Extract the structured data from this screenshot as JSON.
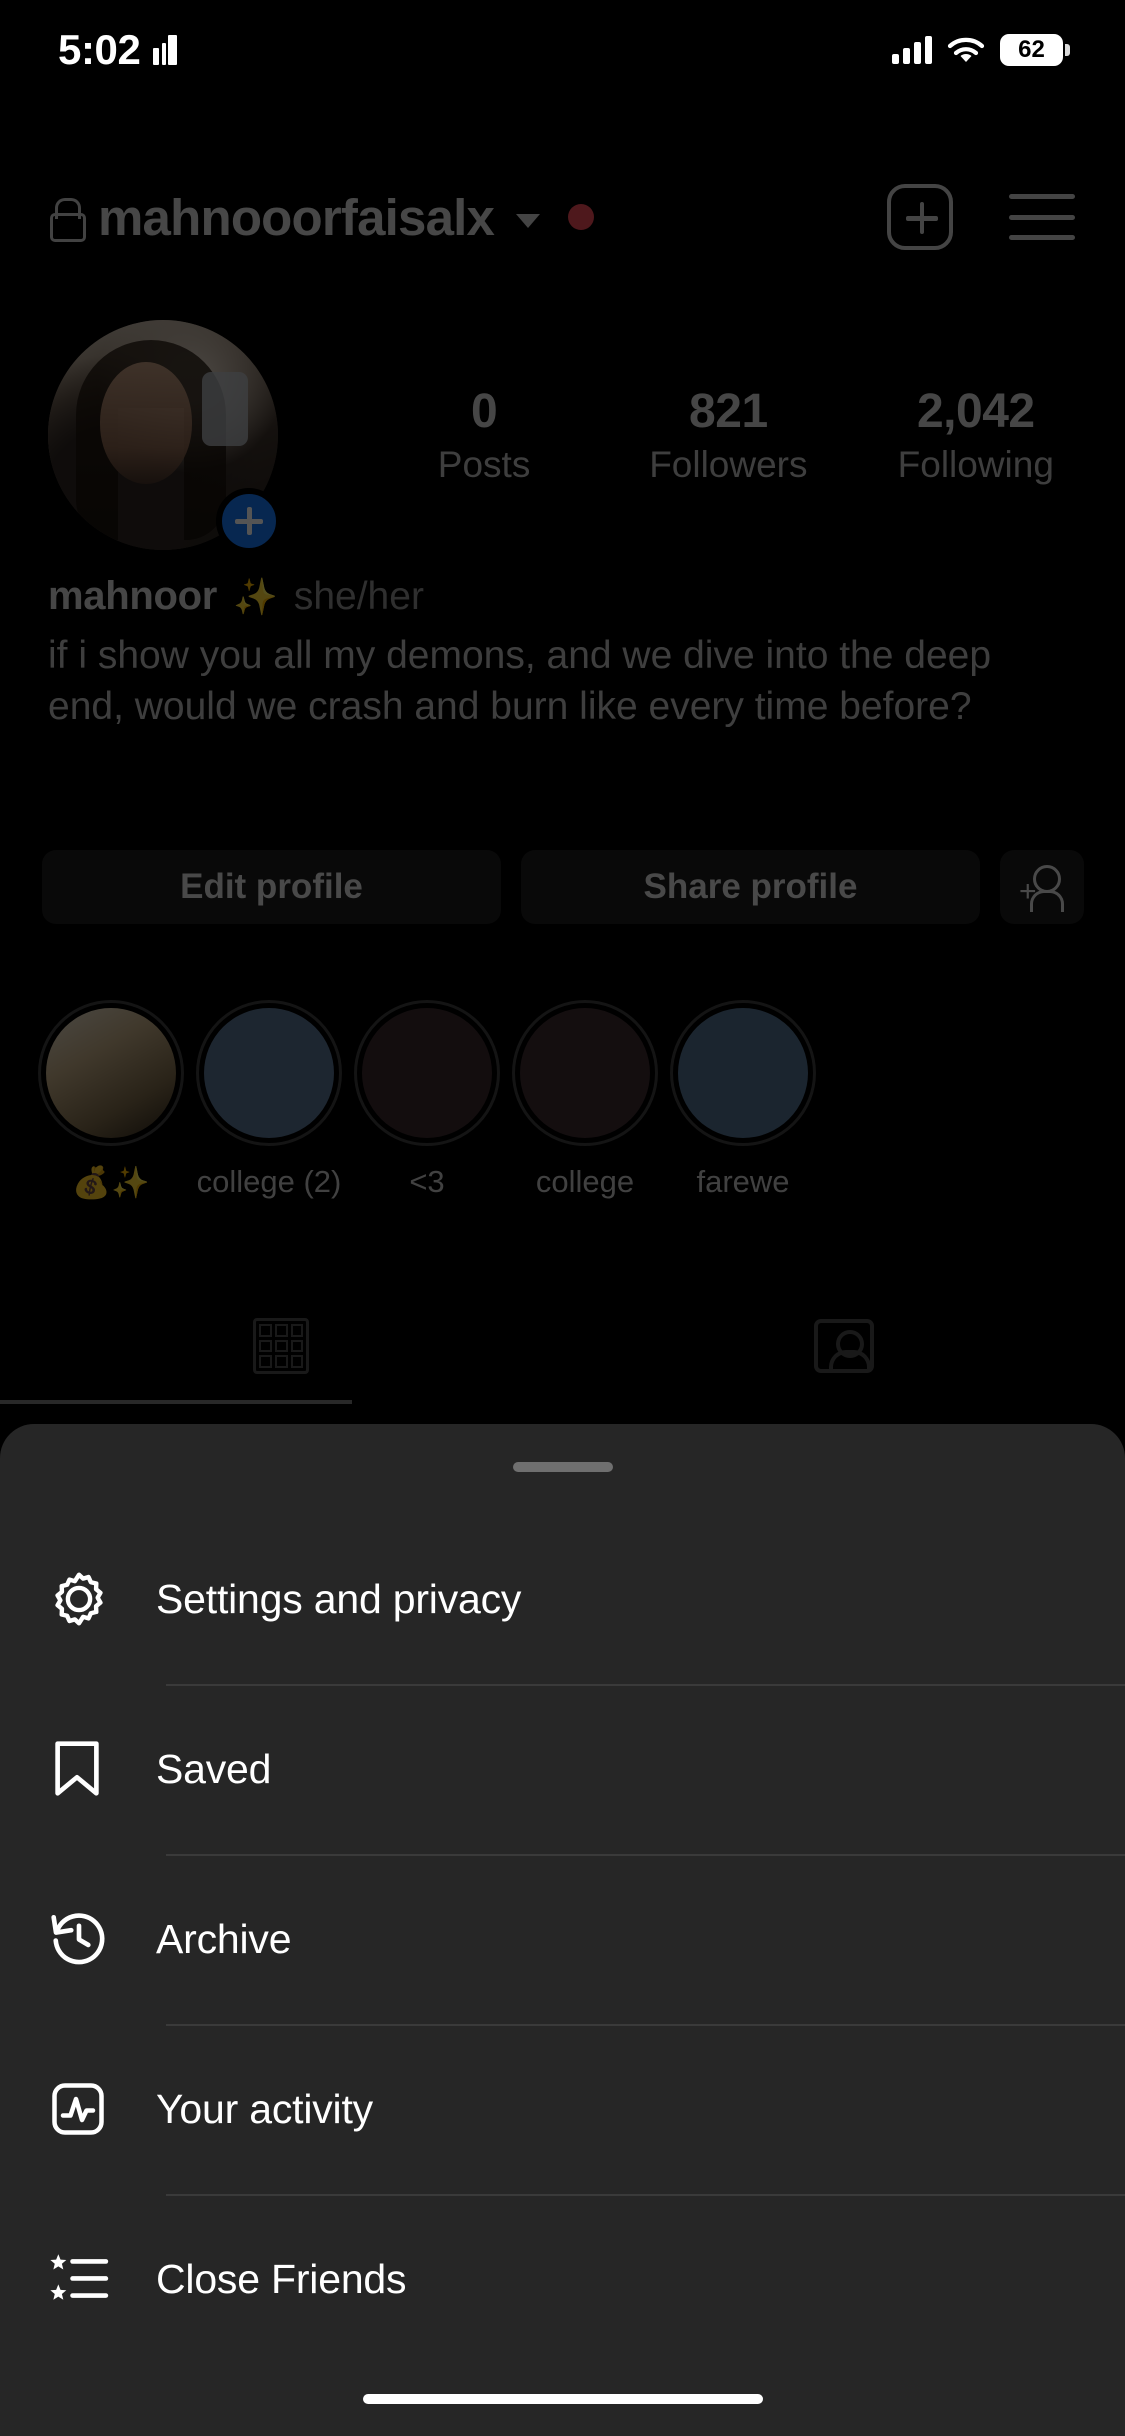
{
  "status_bar": {
    "time": "5:02",
    "battery_percent": "62",
    "icons": [
      "books-icon",
      "cellular-signal-icon",
      "wifi-icon",
      "battery-icon"
    ]
  },
  "header": {
    "lock_icon": "lock-icon",
    "username": "mahnooorfaisalx",
    "chevron": "chevron-down-icon",
    "unread_dot": true,
    "accent_red": "#ED4956",
    "create_icon": "plus-box-icon",
    "menu_icon": "hamburger-menu-icon"
  },
  "profile": {
    "avatar_add_badge": "plus-badge-icon",
    "avatar_badge_color": "#1877F2",
    "stats": [
      {
        "value": "0",
        "label": "Posts"
      },
      {
        "value": "821",
        "label": "Followers"
      },
      {
        "value": "2,042",
        "label": "Following"
      }
    ],
    "display_name": "mahnoor",
    "name_emoji": "✨",
    "pronouns": "she/her",
    "bio": "if i show you all my demons, and we dive into the deep end, would we crash and burn like every time before?"
  },
  "actions": {
    "edit_profile": "Edit profile",
    "share_profile": "Share profile",
    "add_person_icon": "add-person-icon"
  },
  "highlights": [
    {
      "label": "💰✨",
      "color": "#c9b184",
      "has_image": true
    },
    {
      "label": "college (2)",
      "color": "#5a7392",
      "has_image": false
    },
    {
      "label": "<3",
      "color": "#3a2a2d",
      "has_image": false
    },
    {
      "label": "college",
      "color": "#3d2b30",
      "has_image": false
    },
    {
      "label": "farewe",
      "color": "#53718f",
      "has_image": false
    }
  ],
  "tabs": [
    {
      "name": "grid-tab",
      "icon": "grid-icon",
      "active": true
    },
    {
      "name": "tagged-tab",
      "icon": "tagged-person-icon",
      "active": false
    }
  ],
  "sheet": {
    "grab_handle": "drag-handle",
    "items": [
      {
        "label": "Settings and privacy",
        "icon": "gear-icon"
      },
      {
        "label": "Saved",
        "icon": "bookmark-icon"
      },
      {
        "label": "Archive",
        "icon": "clock-rewind-icon"
      },
      {
        "label": "Your activity",
        "icon": "activity-chart-icon"
      },
      {
        "label": "Close Friends",
        "icon": "star-list-icon"
      }
    ]
  }
}
